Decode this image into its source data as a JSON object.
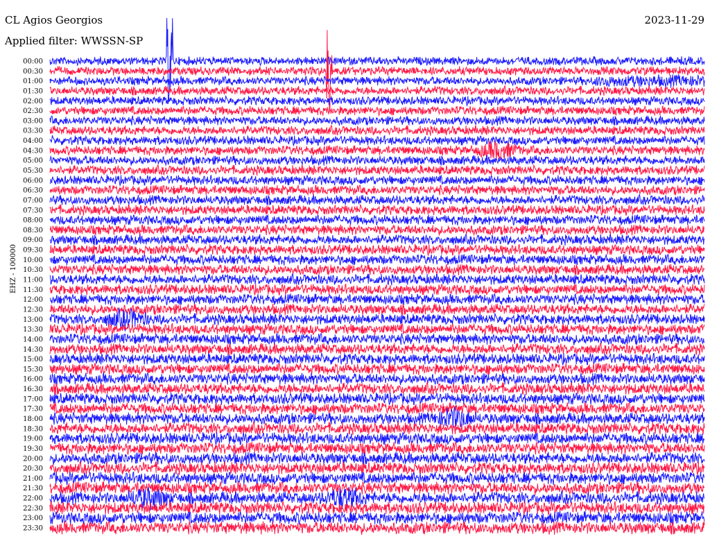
{
  "header": {
    "station": "CL Agios Georgios",
    "date": "2023-11-29",
    "filter": "Applied filter: WWSSN-SP"
  },
  "channel_label": "EHZ - 100000",
  "colors": {
    "trace_a": "#1a1aff",
    "trace_b": "#ff1744",
    "background": "#ffffff",
    "text": "#000000"
  },
  "chart_data": {
    "type": "line",
    "title": "CL Agios Georgios",
    "ylabel": "EHZ - 100000",
    "xlabel": "",
    "grid": false,
    "row_times": [
      "00:00",
      "00:30",
      "01:00",
      "01:30",
      "02:00",
      "02:30",
      "03:00",
      "03:30",
      "04:00",
      "04:30",
      "05:00",
      "05:30",
      "06:00",
      "06:30",
      "07:00",
      "07:30",
      "08:00",
      "08:30",
      "09:00",
      "09:30",
      "10:00",
      "10:30",
      "11:00",
      "11:30",
      "12:00",
      "12:30",
      "13:00",
      "13:30",
      "14:00",
      "14:30",
      "15:00",
      "15:30",
      "16:00",
      "16:30",
      "17:00",
      "17:30",
      "18:00",
      "18:30",
      "19:00",
      "19:30",
      "20:00",
      "20:30",
      "21:00",
      "21:30",
      "22:00",
      "22:30",
      "23:00",
      "23:30"
    ],
    "series_colors_alternating": [
      "blue",
      "red"
    ],
    "notable_events": [
      {
        "row": "00:00",
        "minute": 5.5,
        "description": "large spike"
      },
      {
        "row": "00:30",
        "minute": 12.8,
        "description": "large spike"
      },
      {
        "row": "01:00",
        "minute": 25,
        "description": "elevated amplitude segment"
      },
      {
        "row": "04:30",
        "minute": 20.5,
        "description": "burst"
      },
      {
        "row": "13:00",
        "minute": 3.5,
        "description": "burst"
      },
      {
        "row": "18:00",
        "minute": 18.5,
        "description": "burst"
      },
      {
        "row": "22:00",
        "minute": 4.5,
        "description": "burst"
      },
      {
        "row": "22:00",
        "minute": 13.5,
        "description": "burst"
      }
    ]
  }
}
